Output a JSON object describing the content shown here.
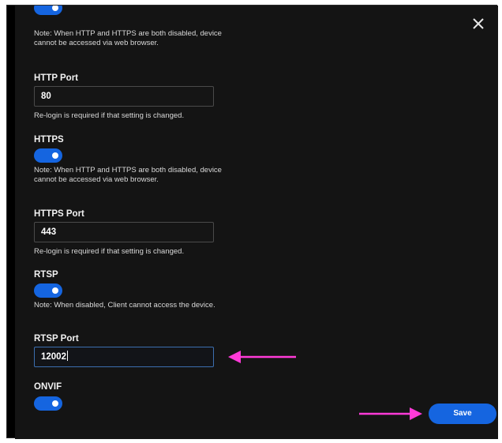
{
  "http_note": "Note: When HTTP and HTTPS are both disabled, device cannot be accessed via web browser.",
  "http_port": {
    "label": "HTTP Port",
    "value": "80",
    "hint": "Re-login is required if that setting is changed."
  },
  "https": {
    "label": "HTTPS",
    "enabled": true,
    "note": "Note: When HTTP and HTTPS are both disabled, device cannot be accessed via web browser."
  },
  "https_port": {
    "label": "HTTPS Port",
    "value": "443",
    "hint": "Re-login is required if that setting is changed."
  },
  "rtsp": {
    "label": "RTSP",
    "enabled": true,
    "note": "Note: When disabled, Client cannot access the device."
  },
  "rtsp_port": {
    "label": "RTSP Port",
    "value": "12002"
  },
  "onvif": {
    "label": "ONVIF",
    "enabled": true
  },
  "save_label": "Save",
  "colors": {
    "accent": "#1565e0",
    "annotation_arrow": "#ff3ad8",
    "background": "#141414"
  },
  "icons": {
    "close": "close-icon"
  }
}
